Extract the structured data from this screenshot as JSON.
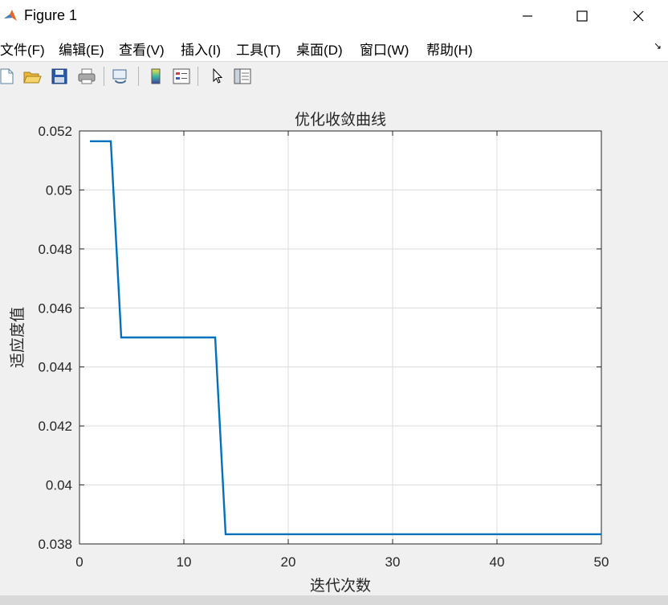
{
  "window": {
    "title": "Figure 1",
    "controls": {
      "minimize": "─",
      "maximize": "☐",
      "close": "✕"
    }
  },
  "menu": {
    "items": [
      "文件(F)",
      "编辑(E)",
      "查看(V)",
      "插入(I)",
      "工具(T)",
      "桌面(D)",
      "窗口(W)",
      "帮助(H)"
    ],
    "corner_icon": "dock-arrow-icon"
  },
  "toolbar": {
    "icons": [
      "new-figure-icon",
      "open-file-icon",
      "save-icon",
      "print-icon",
      "link-plot-icon",
      "colorbar-icon",
      "legend-icon",
      "edit-plot-arrow-icon",
      "property-inspector-icon"
    ]
  },
  "colors": {
    "line": "#0072bd",
    "grid": "#dcdcdc",
    "figure_bg": "#f0f0f0",
    "axes_bg": "#ffffff"
  },
  "chart_data": {
    "type": "line",
    "title": "优化收敛曲线",
    "xlabel": "迭代次数",
    "ylabel": "适应度值",
    "xlim": [
      0,
      50
    ],
    "ylim": [
      0.038,
      0.052
    ],
    "xticks": [
      "0",
      "10",
      "20",
      "30",
      "40",
      "50"
    ],
    "yticks": [
      "0.038",
      "0.04",
      "0.042",
      "0.044",
      "0.046",
      "0.048",
      "0.05",
      "0.052"
    ],
    "grid": true,
    "series": [
      {
        "x": [
          1,
          2,
          3,
          4,
          5,
          6,
          7,
          8,
          9,
          10,
          11,
          12,
          13,
          14,
          15,
          16,
          17,
          18,
          19,
          20,
          21,
          22,
          23,
          24,
          25,
          26,
          27,
          28,
          29,
          30,
          31,
          32,
          33,
          34,
          35,
          36,
          37,
          38,
          39,
          40,
          41,
          42,
          43,
          44,
          45,
          46,
          47,
          48,
          49,
          50
        ],
        "y": [
          0.05165,
          0.05165,
          0.05165,
          0.045,
          0.045,
          0.045,
          0.045,
          0.045,
          0.045,
          0.045,
          0.045,
          0.045,
          0.045,
          0.03833,
          0.03833,
          0.03833,
          0.03833,
          0.03833,
          0.03833,
          0.03833,
          0.03833,
          0.03833,
          0.03833,
          0.03833,
          0.03833,
          0.03833,
          0.03833,
          0.03833,
          0.03833,
          0.03833,
          0.03833,
          0.03833,
          0.03833,
          0.03833,
          0.03833,
          0.03833,
          0.03833,
          0.03833,
          0.03833,
          0.03833,
          0.03833,
          0.03833,
          0.03833,
          0.03833,
          0.03833,
          0.03833,
          0.03833,
          0.03833,
          0.03833,
          0.03833
        ]
      }
    ]
  }
}
